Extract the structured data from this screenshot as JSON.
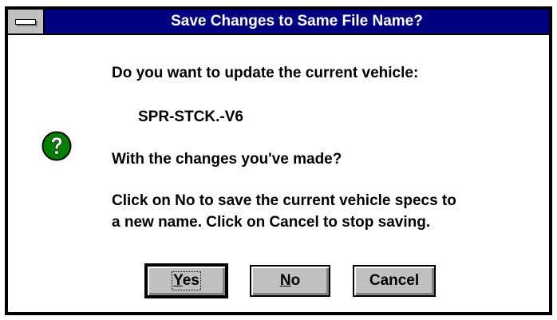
{
  "dialog": {
    "title": "Save Changes to Same File Name?",
    "icon": "question-icon",
    "message_line1": "Do you want to update the current vehicle:",
    "vehicle_name": "SPR-STCK.-V6",
    "message_line2": "With the changes you've made?",
    "message_line3": "Click on No to save the current vehicle specs to",
    "message_line4": "a new name.  Click on Cancel to stop saving."
  },
  "buttons": {
    "yes": {
      "mnemonic": "Y",
      "rest": "es"
    },
    "no": {
      "mnemonic": "N",
      "rest": "o"
    },
    "cancel": {
      "label": "Cancel"
    }
  },
  "colors": {
    "titlebar": "#000080",
    "button_face": "#c0c0c0",
    "icon_green": "#008000"
  }
}
